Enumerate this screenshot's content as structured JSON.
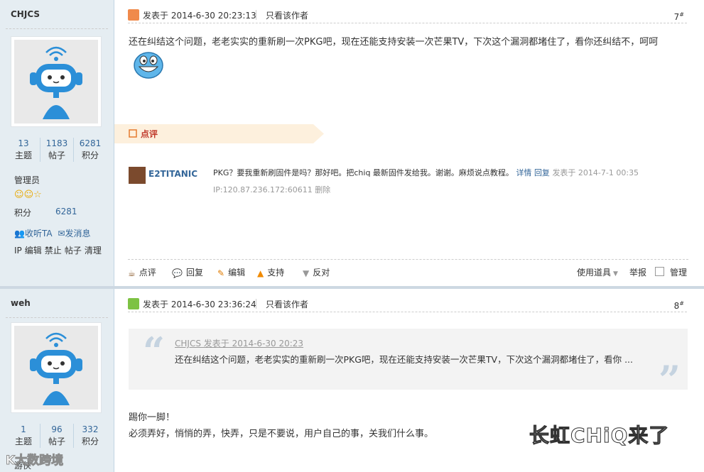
{
  "posts": [
    {
      "author": "CHJCS",
      "stats": [
        {
          "num": "13",
          "label": "主题"
        },
        {
          "num": "1183",
          "label": "帖子"
        },
        {
          "num": "6281",
          "label": "积分"
        }
      ],
      "group": "管理员",
      "score_label": "积分",
      "score_value": "6281",
      "follow": "收听TA",
      "message": "发消息",
      "admin_actions": [
        "IP",
        "编辑",
        "禁止",
        "帖子",
        "清理"
      ],
      "posted": "发表于 2014-6-30 20:23:13",
      "only_author": "只看该作者",
      "floor": "7",
      "content": "还在纠结这个问题，老老实实的重新刷一次PKG吧，现在还能支持安装一次芒果TV，下次这个漏洞都堵住了，看你还纠结不，呵呵",
      "comment_label": "点评",
      "comment": {
        "user": "E2TITANIC",
        "text": "PKG？要我重新刷固件是吗？那好吧。把chiq 最新固件发给我。谢谢。麻烦说点教程。",
        "detail": "详情",
        "reply": "回复",
        "time": "发表于 2014-7-1 00:35",
        "ip": "IP:120.87.236.172:60611",
        "delete": "删除"
      },
      "footer": {
        "comment": "点评",
        "reply": "回复",
        "edit": "编辑",
        "support": "支持",
        "oppose": "反对",
        "tools": "使用道具",
        "report": "举报",
        "manage": "管理"
      }
    },
    {
      "author": "weh",
      "stats": [
        {
          "num": "1",
          "label": "主题"
        },
        {
          "num": "96",
          "label": "帖子"
        },
        {
          "num": "332",
          "label": "积分"
        }
      ],
      "group": "游侠",
      "posted": "发表于 2014-6-30 23:36:24",
      "only_author": "只看该作者",
      "floor": "8",
      "quote_head": "CHJCS 发表于 2014-6-30 20:23",
      "quote_body": "还在纠结这个问题，老老实实的重新刷一次PKG吧，现在还能支持安装一次芒果TV，下次这个漏洞都堵住了，看你 ...",
      "line1": "踢你一脚！",
      "line2": "必须弄好，悄悄的弄，快弄，只是不要说，用户自己的事，关我们什么事。"
    }
  ],
  "watermark_right": "长虹CHiQ来了",
  "watermark_left": "K大数跨境",
  "colors": {
    "link": "#336699",
    "sidebar": "#e5edf2",
    "quote_bg": "#f3f3f3",
    "comment_accent": "#c0392b"
  }
}
